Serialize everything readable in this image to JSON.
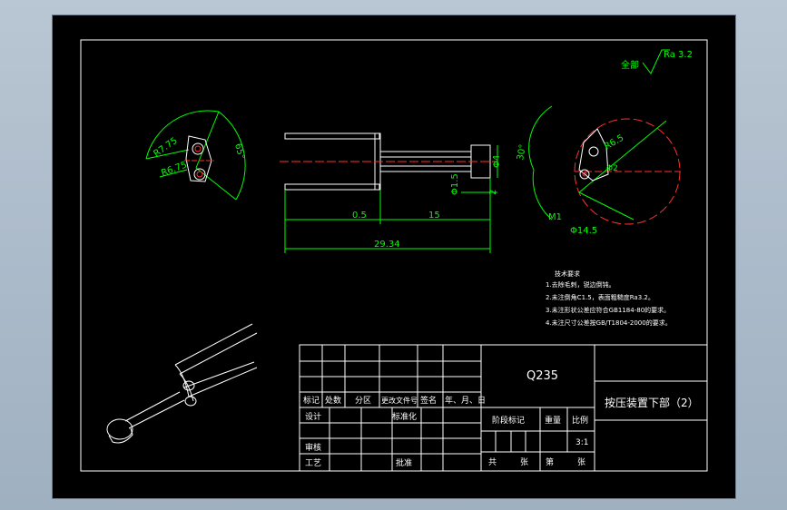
{
  "drawing": {
    "roughness_prefix": "全部",
    "roughness_value": "Ra 3.2",
    "dim_left_r1": "R7.75",
    "dim_left_r2": "R6.75",
    "dim_left_angle": "65°",
    "dim_front_a": "0.5",
    "dim_front_b": "15",
    "dim_front_total": "29.34",
    "dim_front_dia": "Φ1.5",
    "dim_front_right": "2",
    "dim_front_height": "Φ4",
    "dim_right_angle": "30°",
    "dim_right_r": "R6.5",
    "dim_right_m": "M1",
    "dim_right_dia": "Φ14.5",
    "dim_right_small": "Φ2"
  },
  "tech_req": {
    "title": "技术要求",
    "items": [
      "1.去除毛刺，锐边倒钝。",
      "2.未注倒角C1.5，表面粗糙度Ra3.2。",
      "3.未注形状公差应符合GB1184-80的要求。",
      "4.未注尺寸公差按GB/T1804-2000的要求。"
    ]
  },
  "title_block": {
    "material": "Q235",
    "part_name": "按压装置下部（2）",
    "hdr_mark": "标记",
    "hdr_count": "处数",
    "hdr_zone": "分区",
    "hdr_doc": "更改文件号",
    "hdr_sign": "签名",
    "hdr_date": "年、月、日",
    "design": "设计",
    "standard": "标准化",
    "stage_mark": "阶段标记",
    "weight": "重量",
    "scale_label": "比例",
    "scale": "3:1",
    "review": "审核",
    "craft": "工艺",
    "approve": "批准",
    "total": "共",
    "sheets": "张",
    "page": "第",
    "sheet2": "张"
  }
}
